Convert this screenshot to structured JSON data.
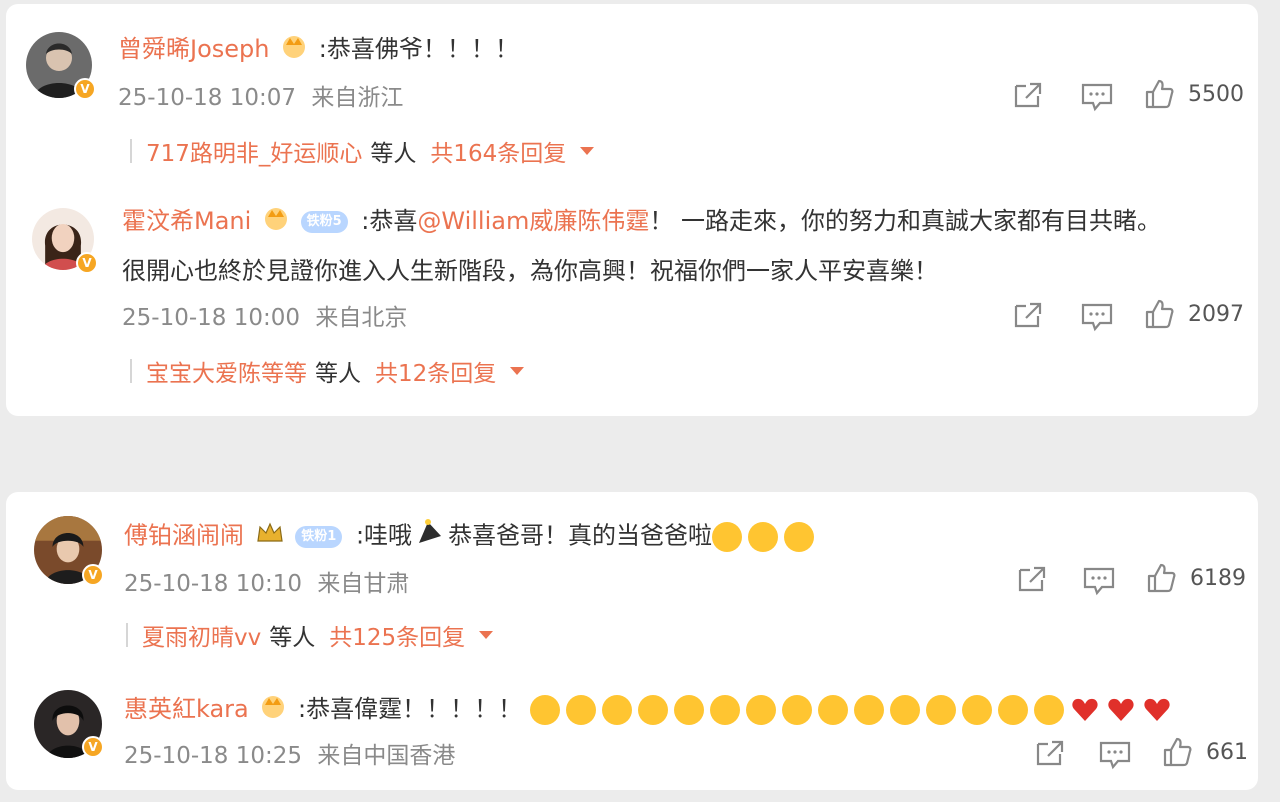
{
  "comments": [
    {
      "username": "曾舜晞Joseph",
      "text": ":恭喜佛爷！！！！",
      "time": "25-10-18 10:07",
      "location": "来自浙江",
      "likes": "5500",
      "replies": {
        "name": "717路明非_好运顺心",
        "middle": "等人",
        "total": "共164条回复"
      }
    },
    {
      "username": "霍汶希Mani",
      "fan_badge": "铁粉5",
      "text_before": ":恭喜",
      "mention": "@William威廉陈伟霆",
      "text_after": "！ 一路走來，你的努力和真誠大家都有目共睹。",
      "text_line2": "很開心也終於見證你進入人生新階段，為你高興！祝福你們一家人平安喜樂！",
      "time": "25-10-18 10:00",
      "location": "来自北京",
      "likes": "2097",
      "replies": {
        "name": "宝宝大爱陈等等",
        "middle": "等人",
        "total": "共12条回复"
      }
    },
    {
      "username": "傅铂涵闹闹",
      "fan_badge": "铁粉1",
      "text_before": ":哇哦",
      "text_after": "恭喜爸哥！真的当爸爸啦",
      "time": "25-10-18 10:10",
      "location": "来自甘肃",
      "likes": "6189",
      "replies": {
        "name": "夏雨初晴vv",
        "middle": "等人",
        "total": "共125条回复"
      }
    },
    {
      "username": "惠英紅kara",
      "text": ":恭喜偉霆！！！！！",
      "time": "25-10-18 10:25",
      "location": "来自中国香港",
      "likes": "661"
    }
  ],
  "icons": [
    "share-icon",
    "comment-icon",
    "like-icon",
    "verified-badge-icon",
    "crown-icon"
  ],
  "colors": {
    "username": "#eb7350",
    "meta": "#8a8a8a",
    "verified": "#f6a623"
  }
}
